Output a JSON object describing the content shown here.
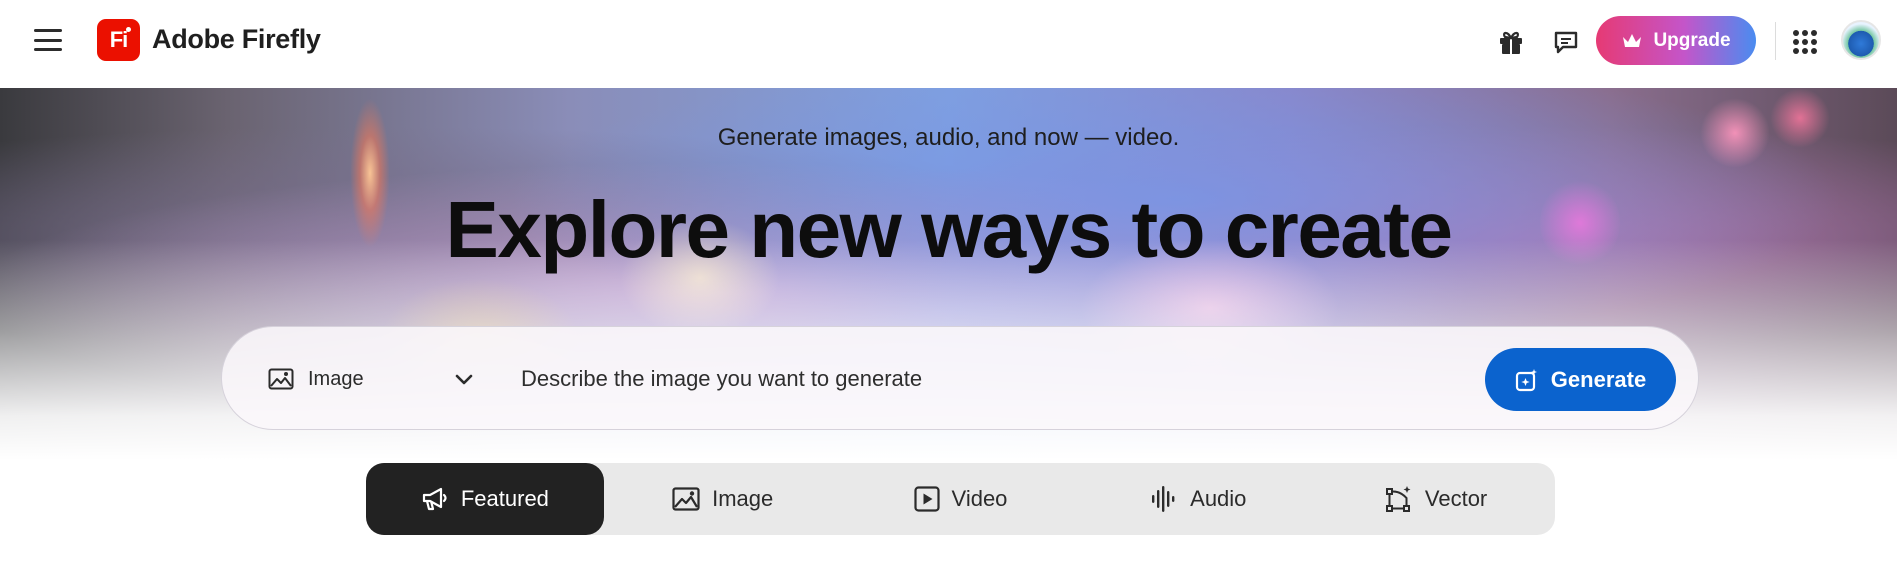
{
  "header": {
    "brand": "Adobe Firefly",
    "logo_text": "Fi",
    "upgrade_label": "Upgrade",
    "icons": [
      "hamburger-menu-icon",
      "gift-icon",
      "feedback-chat-icon",
      "crown-icon",
      "apps-grid-icon"
    ]
  },
  "hero": {
    "subtitle": "Generate images, audio, and now — video.",
    "title": "Explore new ways to create"
  },
  "prompt": {
    "mode": "Image",
    "placeholder": "Describe the image you want to generate",
    "generate_label": "Generate"
  },
  "tabs": [
    {
      "label": "Featured",
      "icon": "megaphone-icon",
      "active": true
    },
    {
      "label": "Image",
      "icon": "image-icon",
      "active": false
    },
    {
      "label": "Video",
      "icon": "video-play-icon",
      "active": false
    },
    {
      "label": "Audio",
      "icon": "audio-waveform-icon",
      "active": false
    },
    {
      "label": "Vector",
      "icon": "vector-icon",
      "active": false
    }
  ],
  "colors": {
    "brand_red": "#eb1000",
    "generate_blue": "#0b63ce",
    "active_tab": "#222222",
    "tab_bar": "#e9e9e9"
  }
}
